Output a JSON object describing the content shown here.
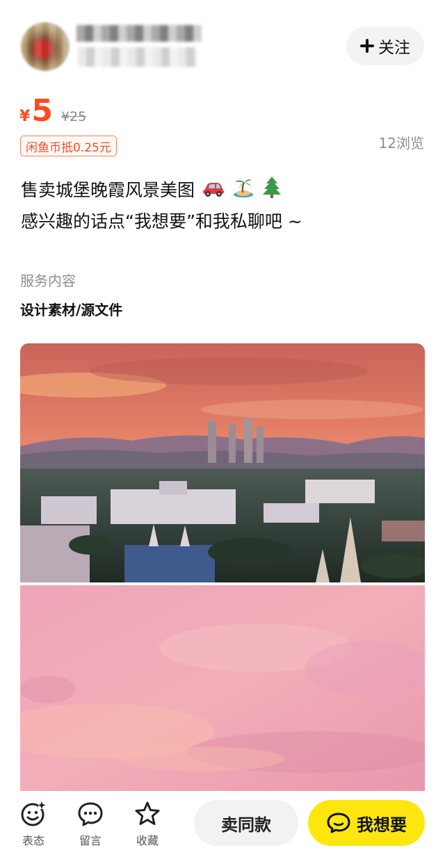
{
  "header": {
    "follow_label": "关注"
  },
  "price": {
    "currency": "¥",
    "current": "5",
    "original": "¥25",
    "coin_deduct": "闲鱼币抵0.25元",
    "views": "12浏览"
  },
  "description": {
    "line1": "售卖城堡晚霞风景美图",
    "line1_emojis": [
      "car-icon",
      "island-icon",
      "tree-icon"
    ],
    "line2": "感兴趣的话点“我想要”和我私聊吧 ~"
  },
  "service": {
    "label": "服务内容",
    "value": "设计素材/源文件"
  },
  "photos": [
    {
      "name": "castle-sunset-photo",
      "colors": {
        "sky": "#e8836d",
        "horizon": "#f0a07a",
        "land": "#3a4a3c"
      }
    },
    {
      "name": "pink-sky-photo",
      "colors": {
        "sky": "#eea0b5",
        "glow": "#f8c0b0"
      }
    }
  ],
  "bottom_bar": {
    "express_label": "表态",
    "comment_label": "留言",
    "favorite_label": "收藏",
    "same_style_label": "卖同款",
    "want_label": "我想要"
  },
  "colors": {
    "accent_price": "#ff4a1f",
    "want_button": "#ffe60f"
  }
}
